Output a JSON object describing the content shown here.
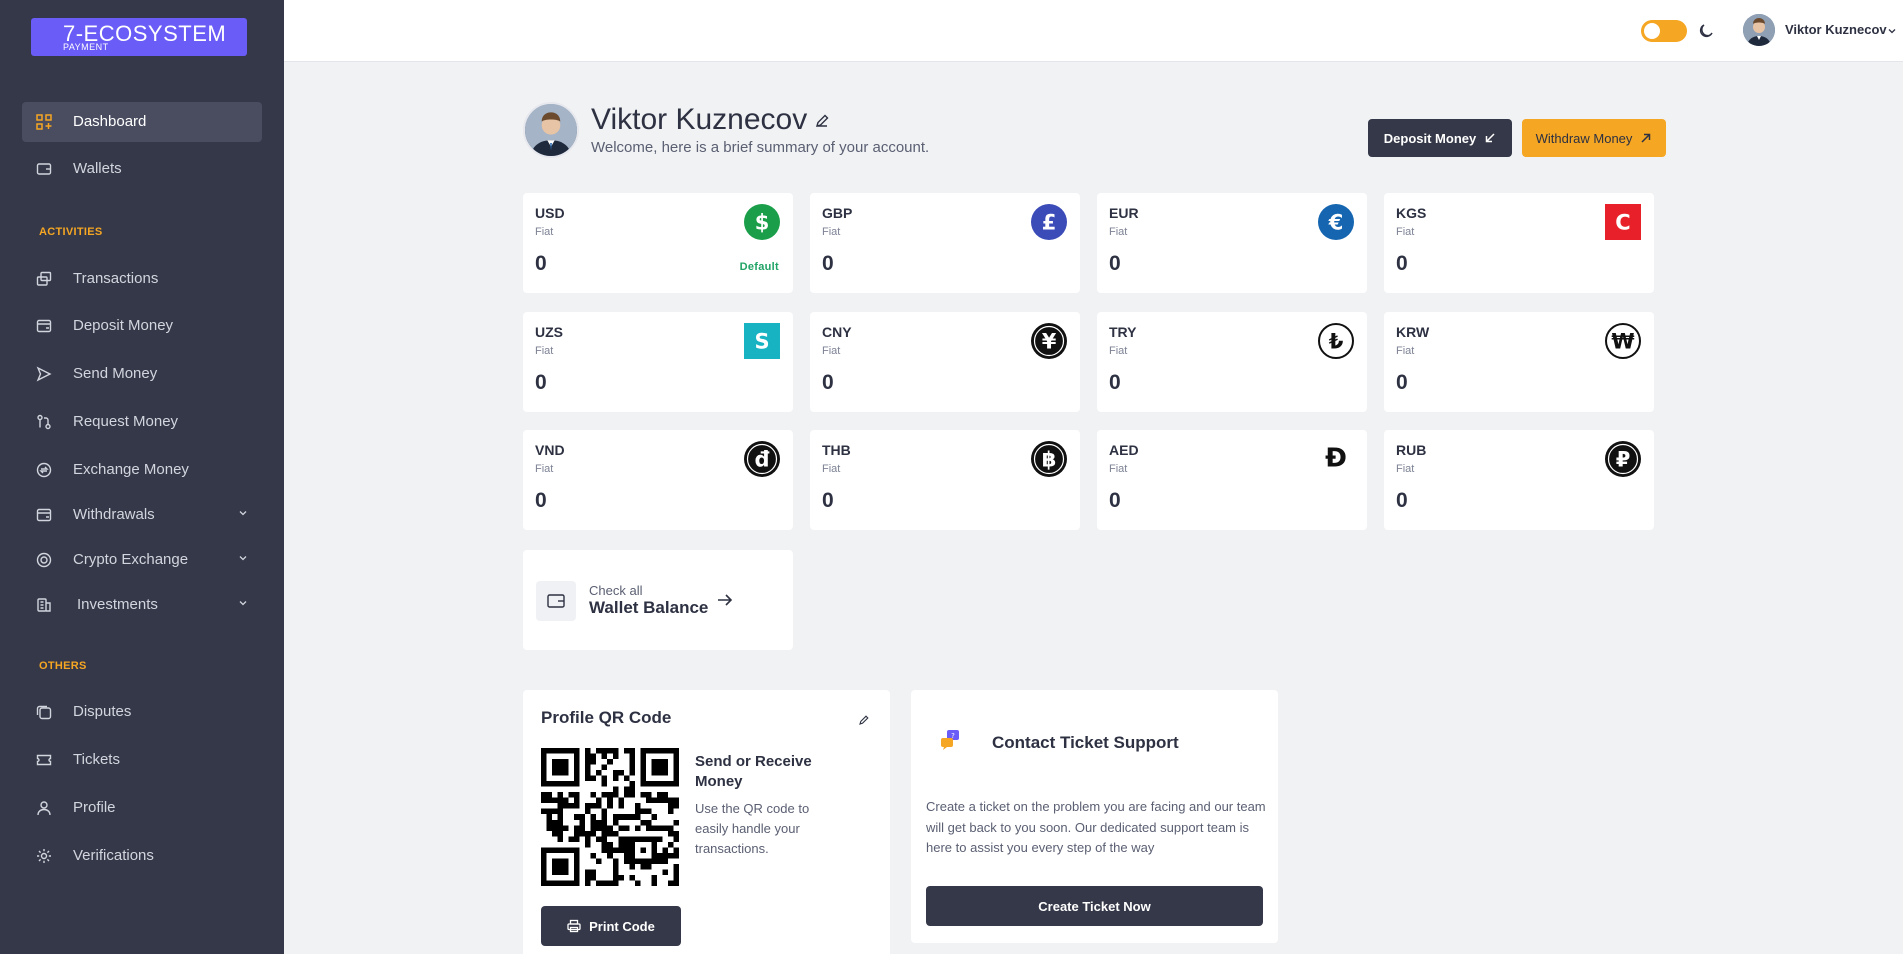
{
  "brand": {
    "name": "7-ECOSYSTEM",
    "tagline": "PAYMENT"
  },
  "sidebar": {
    "items": [
      {
        "label": "Dashboard",
        "icon": "dashboard-grid-icon",
        "active": true
      },
      {
        "label": "Wallets",
        "icon": "wallet-icon"
      },
      {
        "label": "Transactions",
        "icon": "transactions-icon"
      },
      {
        "label": "Deposit Money",
        "icon": "deposit-icon"
      },
      {
        "label": "Send Money",
        "icon": "send-icon"
      },
      {
        "label": "Request Money",
        "icon": "request-icon"
      },
      {
        "label": "Exchange Money",
        "icon": "exchange-icon"
      },
      {
        "label": "Withdrawals",
        "icon": "withdraw-icon",
        "expandable": true
      },
      {
        "label": "Crypto Exchange",
        "icon": "crypto-icon",
        "expandable": true
      },
      {
        "label": "Investments",
        "icon": "investments-icon",
        "expandable": true
      },
      {
        "label": "Disputes",
        "icon": "disputes-icon"
      },
      {
        "label": "Tickets",
        "icon": "ticket-icon"
      },
      {
        "label": "Profile",
        "icon": "user-icon"
      },
      {
        "label": "Verifications",
        "icon": "gear-icon"
      }
    ],
    "sections": {
      "activities": "ACTIVITIES",
      "others": "OTHERS"
    }
  },
  "topbar": {
    "user_name": "Viktor Kuznecov",
    "theme_toggle": "on"
  },
  "header": {
    "name": "Viktor Kuznecov",
    "welcome": "Welcome, here is a brief summary of your account.",
    "deposit_label": "Deposit Money",
    "withdraw_label": "Withdraw Money"
  },
  "currencies": [
    {
      "code": "USD",
      "type": "Fiat",
      "balance": "0",
      "badge": "Default",
      "symbol": "$",
      "color": "#1a9e4a",
      "shape": "circle"
    },
    {
      "code": "GBP",
      "type": "Fiat",
      "balance": "0",
      "symbol": "£",
      "color": "#3b4cb8",
      "shape": "circle"
    },
    {
      "code": "EUR",
      "type": "Fiat",
      "balance": "0",
      "symbol": "€",
      "color": "#1565b0",
      "shape": "circle"
    },
    {
      "code": "KGS",
      "type": "Fiat",
      "balance": "0",
      "symbol": "C",
      "color": "#e8202a",
      "shape": "square"
    },
    {
      "code": "UZS",
      "type": "Fiat",
      "balance": "0",
      "symbol": "S",
      "color": "#17b3c3",
      "shape": "square"
    },
    {
      "code": "CNY",
      "type": "Fiat",
      "balance": "0",
      "symbol": "¥",
      "color": "#111111",
      "shape": "circle"
    },
    {
      "code": "TRY",
      "type": "Fiat",
      "balance": "0",
      "symbol": "₺",
      "color": "#111111",
      "shape": "ring"
    },
    {
      "code": "KRW",
      "type": "Fiat",
      "balance": "0",
      "symbol": "₩",
      "color": "#111111",
      "shape": "ring"
    },
    {
      "code": "VND",
      "type": "Fiat",
      "balance": "0",
      "symbol": "đ",
      "color": "#111111",
      "shape": "circle"
    },
    {
      "code": "THB",
      "type": "Fiat",
      "balance": "0",
      "symbol": "฿",
      "color": "#111111",
      "shape": "circle"
    },
    {
      "code": "AED",
      "type": "Fiat",
      "balance": "0",
      "symbol": "Đ",
      "color": "#111111",
      "shape": "plain"
    },
    {
      "code": "RUB",
      "type": "Fiat",
      "balance": "0",
      "symbol": "₽",
      "color": "#111111",
      "shape": "circle"
    }
  ],
  "wallet_card": {
    "pre": "Check all",
    "title": "Wallet Balance"
  },
  "qr_panel": {
    "title": "Profile QR Code",
    "heading": "Send or Receive Money",
    "text": "Use the QR code to easily handle your transactions.",
    "print_label": "Print Code"
  },
  "support": {
    "title": "Contact Ticket Support",
    "text": "Create a ticket on the problem you are facing and our team will get back to you soon. Our dedicated support team is here to assist you every step of the way",
    "button": "Create Ticket Now"
  },
  "colors": {
    "sidebar": "#353848",
    "accent": "#f5a623",
    "brand": "#6a5cf6",
    "dark_button": "#353848"
  }
}
